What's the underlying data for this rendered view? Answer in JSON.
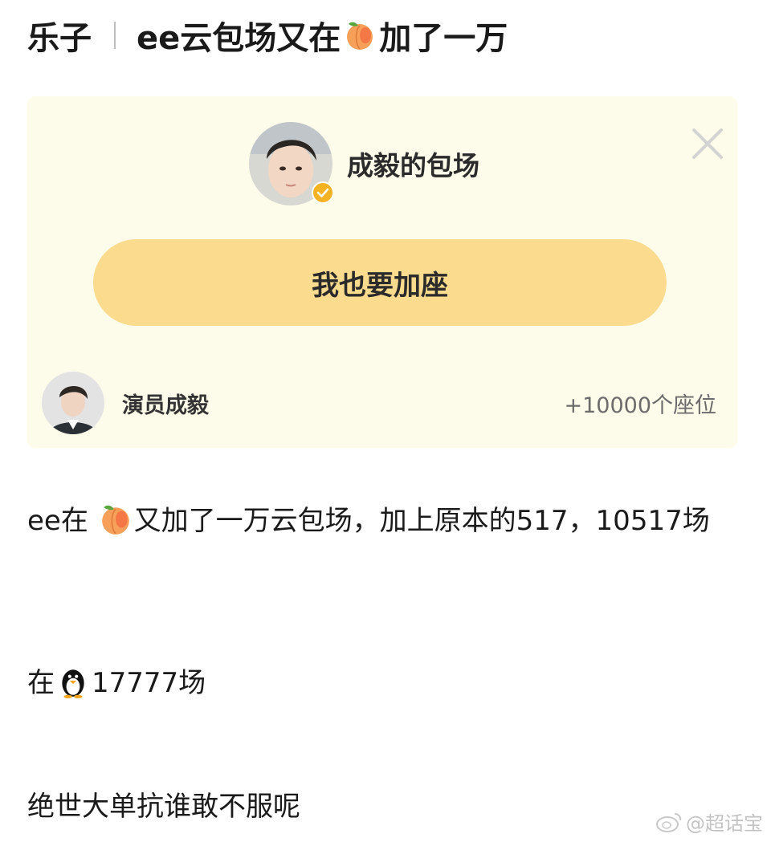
{
  "post": {
    "title_prefix": "乐子",
    "title_before_emoji": "ee云包场又在",
    "title_after_emoji": "加了一万"
  },
  "card": {
    "host_name": "成毅的包场",
    "join_button": "我也要加座",
    "actor_name": "演员成毅",
    "seats_text": "+10000个座位"
  },
  "body": {
    "line1_before_emoji": "ee在",
    "line1_after_emoji": "又加了一万云包场，加上原本的517，10517场",
    "line2_before_emoji": "在",
    "line2_after_emoji": "17777场",
    "line3": "绝世大单抗谁敢不服呢"
  },
  "watermark": {
    "text": "@超话宝"
  },
  "icons": {
    "peach": "peach-emoji-icon",
    "penguin": "penguin-emoji-icon",
    "close": "close-icon",
    "verified": "verified-badge-icon",
    "weibo": "weibo-logo-icon"
  },
  "colors": {
    "card_bg": "#fdfbe9",
    "button_bg": "#fbdc8f",
    "seats_text": "#6b6b6b",
    "verified": "#f5b324"
  }
}
